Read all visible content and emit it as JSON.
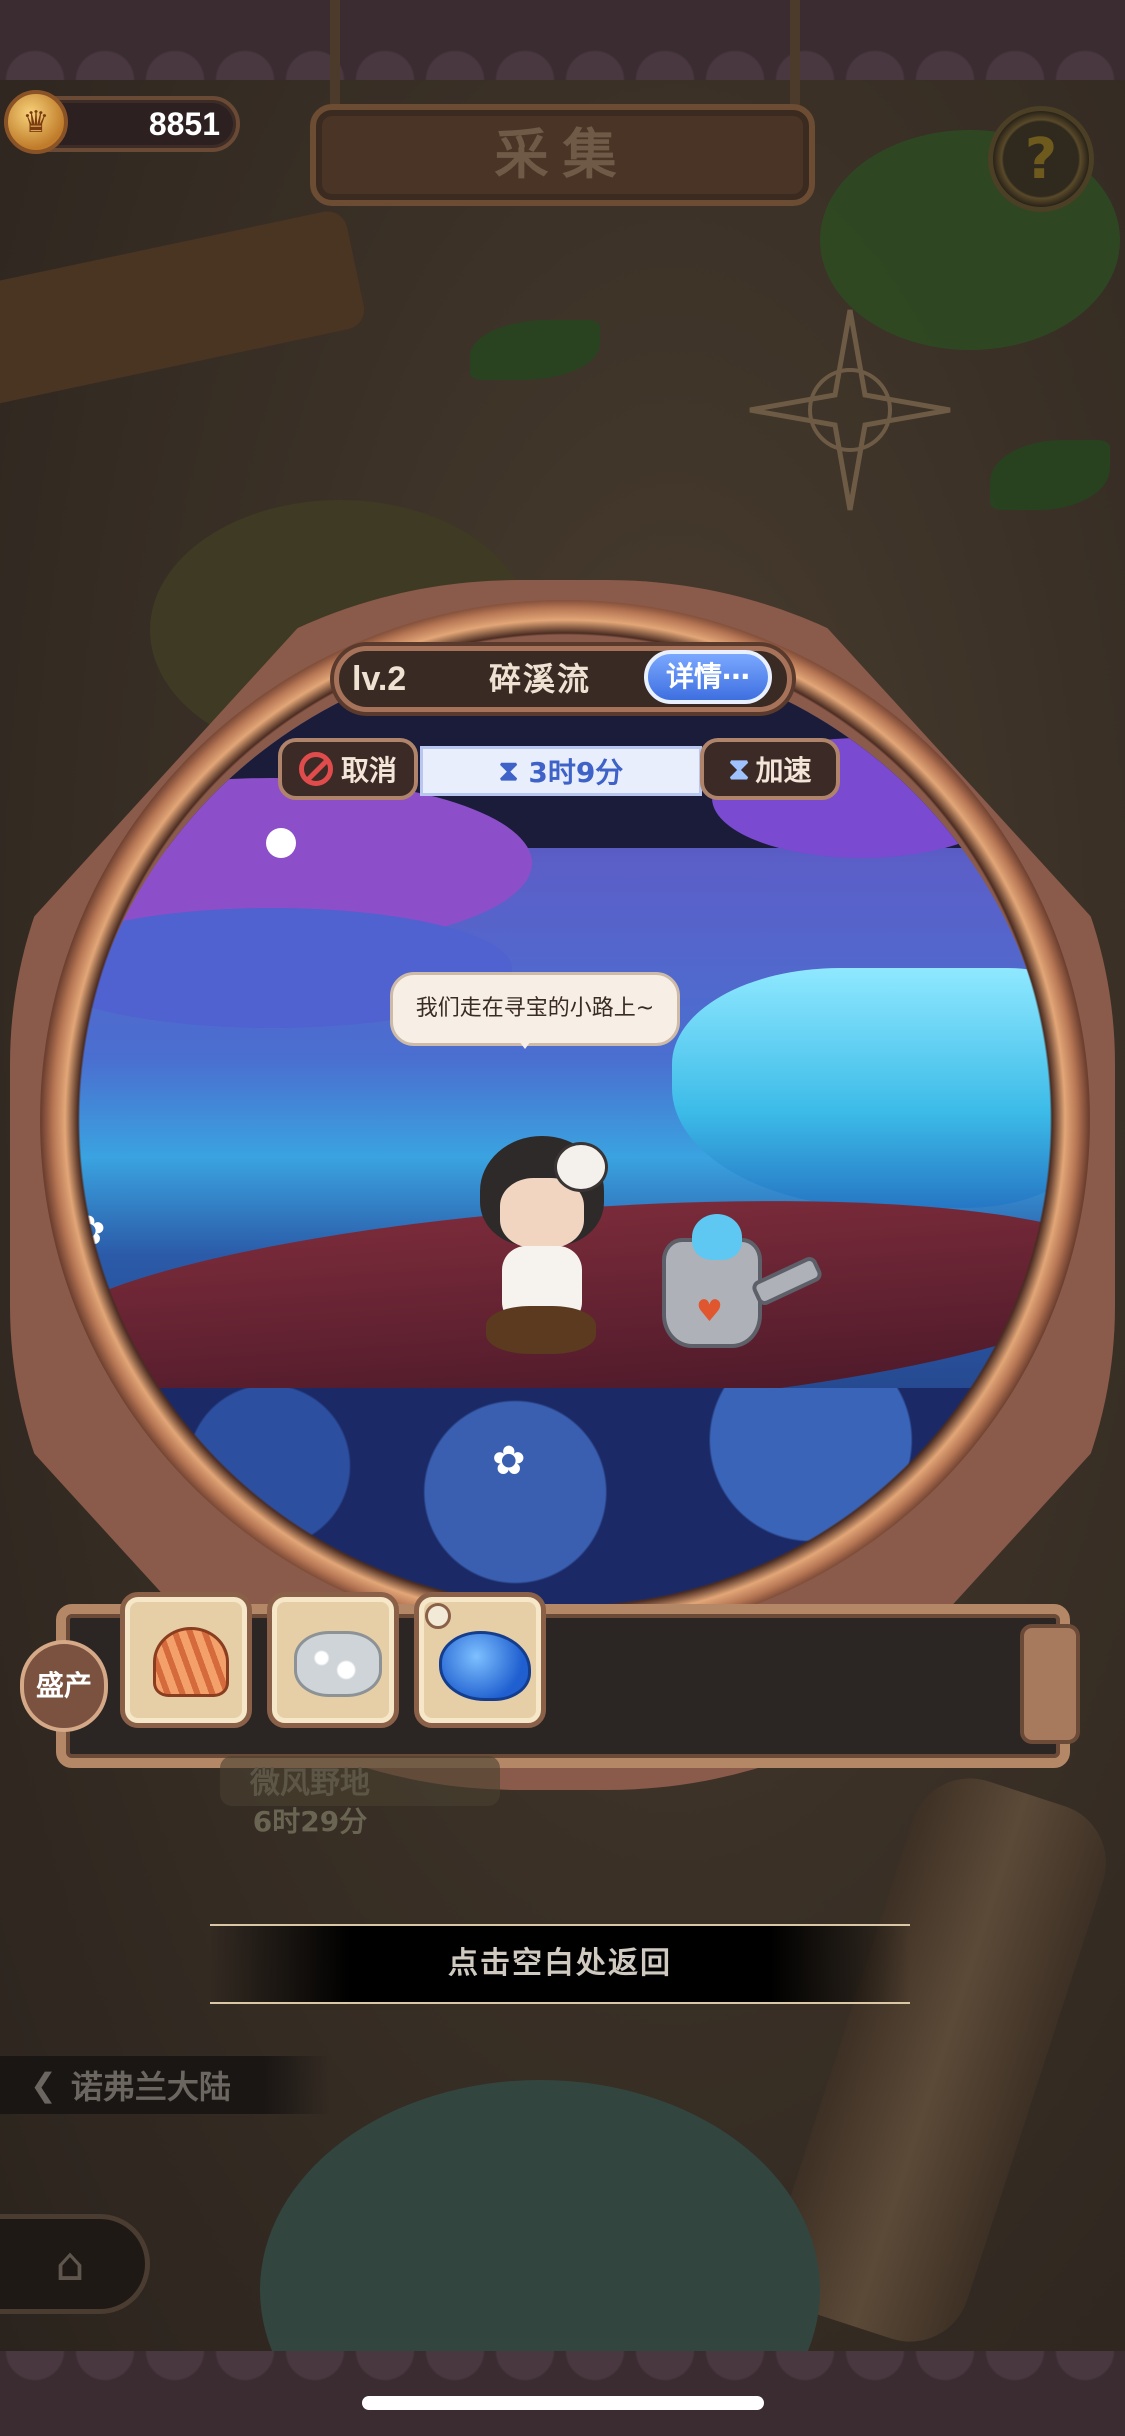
{
  "header": {
    "coins": "8851",
    "coin_icon": "crown-coin-icon",
    "title": "采集",
    "help_icon": "question-icon"
  },
  "location": {
    "level": "lv.2",
    "name": "碎溪流",
    "detail_label": "详情"
  },
  "timer": {
    "cancel_label": "取消",
    "remaining": "3时9分",
    "speed_label": "加速"
  },
  "scene": {
    "speech": "我们走在寻宝的小路上~"
  },
  "produce": {
    "label": "盛产",
    "items": [
      {
        "icon": "shell-icon"
      },
      {
        "icon": "salt-crystal-icon"
      },
      {
        "icon": "blue-slime-icon"
      }
    ]
  },
  "background": {
    "faded_name": "微风野地",
    "faded_time": "6时29分",
    "return_hint": "点击空白处返回",
    "region_name": "诺弗兰大陆"
  }
}
